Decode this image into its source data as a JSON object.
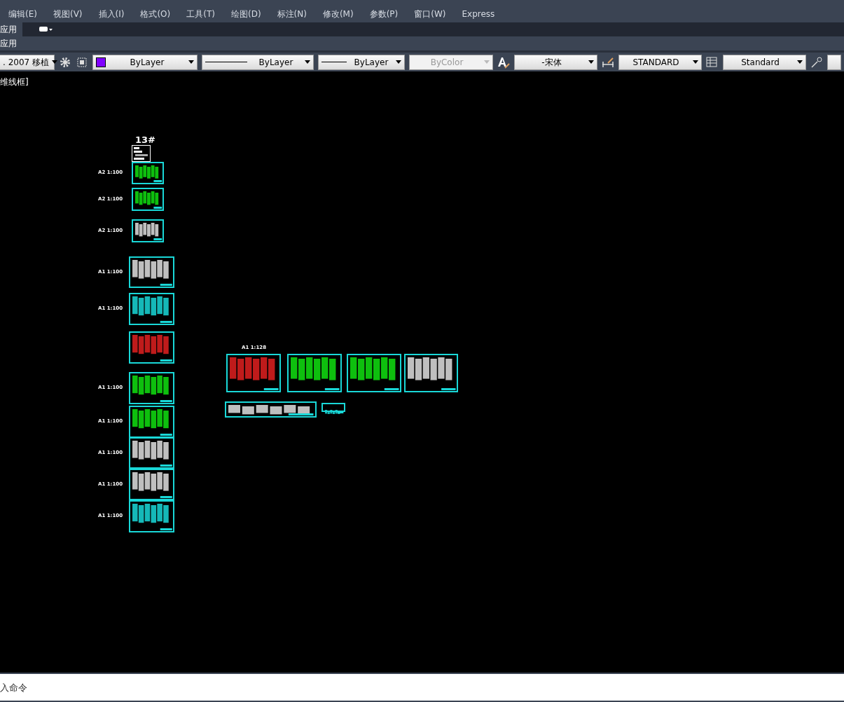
{
  "menu": [
    "编辑(E)",
    "视图(V)",
    "插入(I)",
    "格式(O)",
    "工具(T)",
    "绘图(D)",
    "标注(N)",
    "修改(M)",
    "参数(P)",
    "窗口(W)",
    "Express"
  ],
  "ribbon": {
    "tabs": [
      {
        "label": "应用",
        "selected": true
      }
    ],
    "panel_label": "应用"
  },
  "toolbar": {
    "combos": [
      {
        "kind": "plain",
        "value": ". 2007 移植",
        "disabled": false
      },
      {
        "kind": "color",
        "value": "ByLayer",
        "color": "#8000ff",
        "disabled": false
      },
      {
        "kind": "line",
        "value": "ByLayer",
        "disabled": false
      },
      {
        "kind": "line",
        "value": "ByLayer",
        "disabled": false
      },
      {
        "kind": "plain",
        "value": "ByColor",
        "disabled": true
      },
      {
        "kind": "plain",
        "value": "-宋体",
        "disabled": false
      },
      {
        "kind": "plain",
        "value": "STANDARD",
        "disabled": false
      },
      {
        "kind": "plain",
        "value": "Standard",
        "disabled": false
      }
    ]
  },
  "viewport": {
    "label": "维线框]",
    "group_title": "13#",
    "scale_labels": [
      "A2 1:100",
      "A2 1:100",
      "A2 1:100",
      "A1 1:100",
      "A1 1:100",
      "A1 1:100",
      "A1 1:100",
      "A1 1:100",
      "A1 1:100",
      "A1 1:100",
      "A1 1:128"
    ]
  },
  "command_line": {
    "placeholder": "入命令"
  }
}
